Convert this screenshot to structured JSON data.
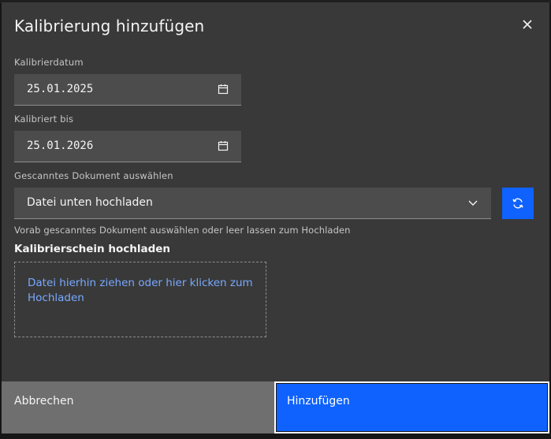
{
  "modal": {
    "title": "Kalibrierung hinzufügen",
    "close_icon": "close-icon"
  },
  "fields": {
    "calibration_date": {
      "label": "Kalibrierdatum",
      "value": "25.01.2025",
      "icon": "calendar-icon"
    },
    "calibrated_until": {
      "label": "Kalibriert bis",
      "value": "25.01.2026",
      "icon": "calendar-icon"
    },
    "scanned_document": {
      "label": "Gescanntes Dokument auswählen",
      "value": "Datei unten hochladen",
      "icon": "chevron-down-icon",
      "helper": "Vorab gescanntes Dokument auswählen oder leer lassen zum Hochladen"
    },
    "refresh_icon": "refresh-icon"
  },
  "upload": {
    "title": "Kalibrierschein hochladen",
    "dropzone_text": "Datei hierhin ziehen oder hier klicken zum Hochladen"
  },
  "footer": {
    "cancel_label": "Abbrechen",
    "submit_label": "Hinzufügen"
  },
  "colors": {
    "modal_bg": "#393939",
    "input_bg": "#4c4c4c",
    "primary": "#0f62fe",
    "secondary": "#6f6f6f",
    "link": "#78a9ff"
  }
}
